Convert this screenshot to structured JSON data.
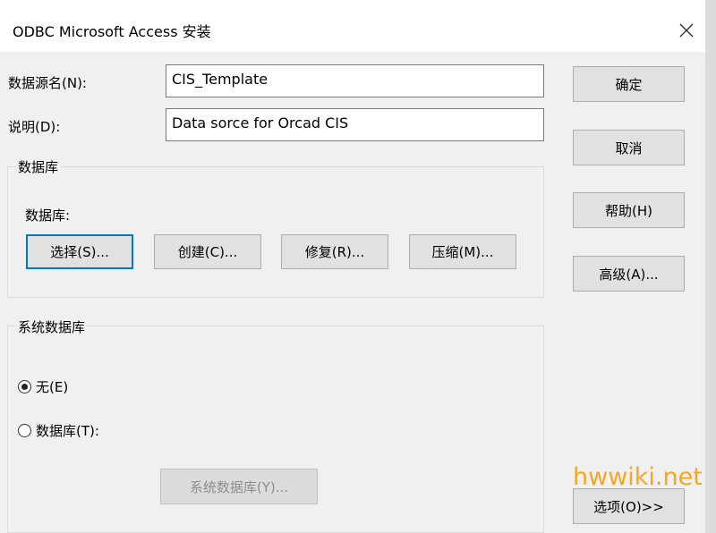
{
  "window": {
    "title": "ODBC Microsoft Access 安装"
  },
  "fields": {
    "dsn_label": "数据源名(N):",
    "dsn_value": "CIS_Template",
    "desc_label": "说明(D):",
    "desc_value": "Data sorce for Orcad CIS"
  },
  "database_group": {
    "title": "数据库",
    "db_label": "数据库:",
    "buttons": [
      "选择(S)...",
      "创建(C)...",
      "修复(R)...",
      "压缩(M)..."
    ]
  },
  "system_db_group": {
    "title": "系统数据库",
    "radio_none": "无(E)",
    "radio_db": "数据库(T):",
    "sysdb_button": "系统数据库(Y)..."
  },
  "side_buttons": {
    "ok": "确定",
    "cancel": "取消",
    "help": "帮助(H)",
    "advanced": "高级(A)...",
    "options": "选项(O)>>"
  },
  "watermark": "hwwiki.net",
  "colors": {
    "accent": "#0078d7",
    "watermark": "#f5a623"
  }
}
